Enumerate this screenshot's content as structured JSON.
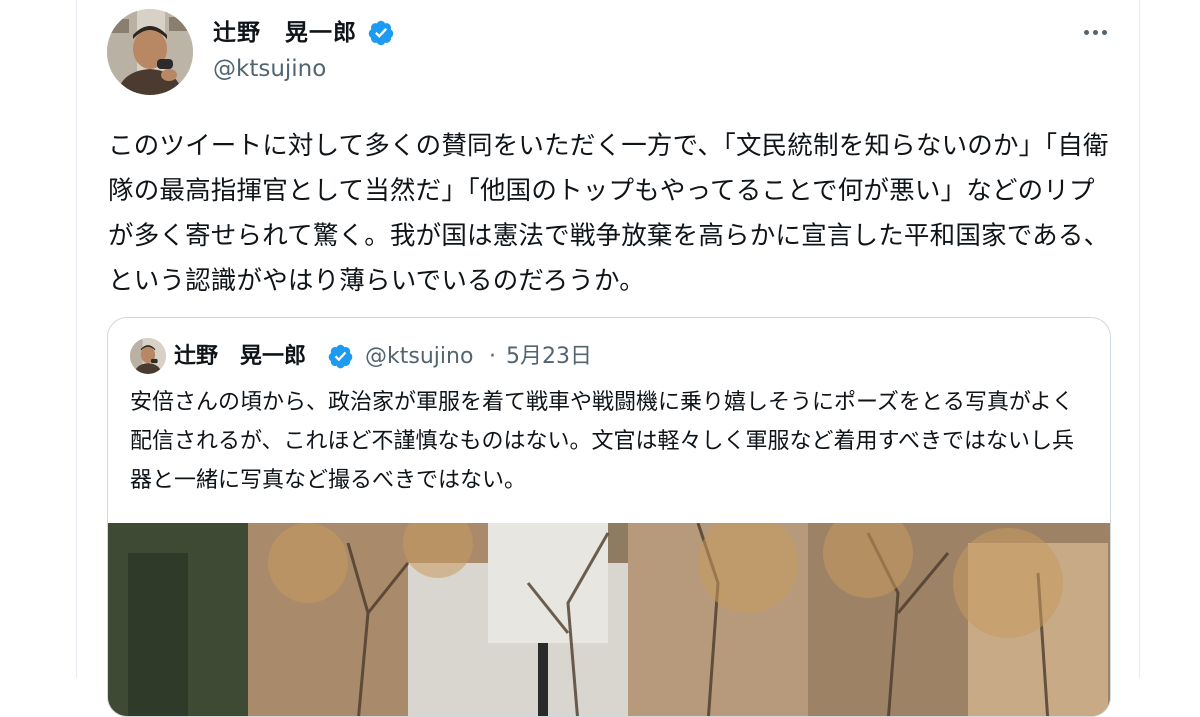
{
  "tweet": {
    "author": {
      "name": "辻野　晃一郎",
      "handle": "@ktsujino",
      "verified": true,
      "avatar_icon": "profile-photo-avatar"
    },
    "more_icon": "more-horizontal-icon",
    "text": "このツイートに対して多くの賛同をいただく一方で、「文民統制を知らないのか」「自衛隊の最高指揮官として当然だ」「他国のトップもやってることで何が悪い」などのリプが多く寄せられて驚く。我が国は憲法で戦争放棄を高らかに宣言した平和国家である、という認識がやはり薄らいでいるのだろうか。"
  },
  "quoted_tweet": {
    "author": {
      "name": "辻野　晃一郎",
      "handle": "@ktsujino",
      "verified": true
    },
    "separator": "·",
    "date": "5月23日",
    "text": "安倍さんの頃から、政治家が軍服を着て戦車や戦闘機に乗り嬉しそうにポーズをとる写真がよく配信されるが、これほど不謹慎なものはない。文官は軽々しく軍服など着用すべきではないし兵器と一緒に写真など撮るべきではない。",
    "media": "outdoor-trees-photo"
  },
  "colors": {
    "text_primary": "#0f1419",
    "text_secondary": "#536471",
    "verified_blue": "#1d9bf0",
    "border": "#cfd9de"
  }
}
